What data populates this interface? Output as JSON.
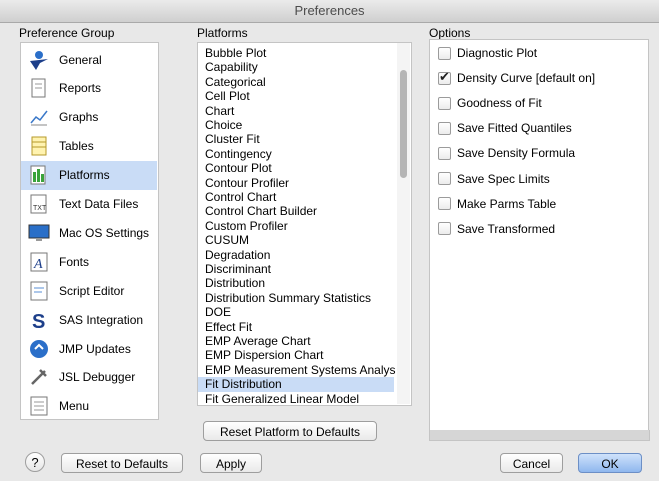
{
  "window": {
    "title": "Preferences"
  },
  "preference_group": {
    "label": "Preference Group",
    "items": [
      {
        "label": "General",
        "icon": "general-icon"
      },
      {
        "label": "Reports",
        "icon": "reports-icon"
      },
      {
        "label": "Graphs",
        "icon": "graphs-icon"
      },
      {
        "label": "Tables",
        "icon": "tables-icon"
      },
      {
        "label": "Platforms",
        "icon": "platforms-icon",
        "selected": true
      },
      {
        "label": "Text Data Files",
        "icon": "text-data-files-icon"
      },
      {
        "label": "Mac OS Settings",
        "icon": "mac-os-settings-icon"
      },
      {
        "label": "Fonts",
        "icon": "fonts-icon"
      },
      {
        "label": "Script Editor",
        "icon": "script-editor-icon"
      },
      {
        "label": "SAS Integration",
        "icon": "sas-integration-icon"
      },
      {
        "label": "JMP Updates",
        "icon": "jmp-updates-icon"
      },
      {
        "label": "JSL Debugger",
        "icon": "jsl-debugger-icon"
      },
      {
        "label": "Menu",
        "icon": "menu-icon"
      }
    ]
  },
  "platforms": {
    "label": "Platforms",
    "items": [
      "Bubble Plot",
      "Capability",
      "Categorical",
      "Cell Plot",
      "Chart",
      "Choice",
      "Cluster Fit",
      "Contingency",
      "Contour Plot",
      "Contour Profiler",
      "Control Chart",
      "Control Chart Builder",
      "Custom Profiler",
      "CUSUM",
      "Degradation",
      "Discriminant",
      "Distribution",
      "Distribution Summary Statistics",
      "DOE",
      "Effect Fit",
      "EMP Average Chart",
      "EMP Dispersion Chart",
      "EMP Measurement Systems Analys",
      "Fit Distribution",
      "Fit Generalized Linear Model"
    ],
    "selected": "Fit Distribution",
    "reset_button": "Reset Platform to Defaults"
  },
  "options": {
    "label": "Options",
    "items": [
      {
        "label": "Diagnostic Plot",
        "checked": false
      },
      {
        "label": "Density Curve [default on]",
        "checked": true
      },
      {
        "label": "Goodness of Fit",
        "checked": false
      },
      {
        "label": "Save Fitted Quantiles",
        "checked": false
      },
      {
        "label": "Save Density Formula",
        "checked": false
      },
      {
        "label": "Save Spec Limits",
        "checked": false
      },
      {
        "label": "Make Parms Table",
        "checked": false
      },
      {
        "label": "Save Transformed",
        "checked": false
      }
    ]
  },
  "footer": {
    "help": "?",
    "reset_defaults": "Reset to Defaults",
    "apply": "Apply",
    "cancel": "Cancel",
    "ok": "OK"
  }
}
